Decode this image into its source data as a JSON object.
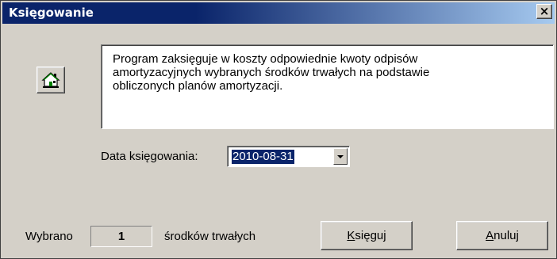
{
  "window": {
    "title": "Księgowanie",
    "close_label": "×"
  },
  "header": {
    "icon": "home-icon",
    "description": "Program zaksięguje w koszty odpowiednie kwoty odpisów\namortyzacyjnych wybranych środków trwałych na podstawie\nobliczonych planów amortyzacji."
  },
  "date": {
    "label": "Data księgowania:",
    "value": "2010-08-31"
  },
  "footer": {
    "selected_label": "Wybrano",
    "selected_count": "1",
    "assets_label": "środków trwałych"
  },
  "buttons": {
    "post": {
      "mnemonic": "K",
      "rest": "sięguj"
    },
    "cancel": {
      "mnemonic": "A",
      "rest": "nuluj"
    }
  },
  "colors": {
    "titlebar": "#0a246a",
    "face": "#d4d0c8",
    "selection": "#0a246a"
  }
}
